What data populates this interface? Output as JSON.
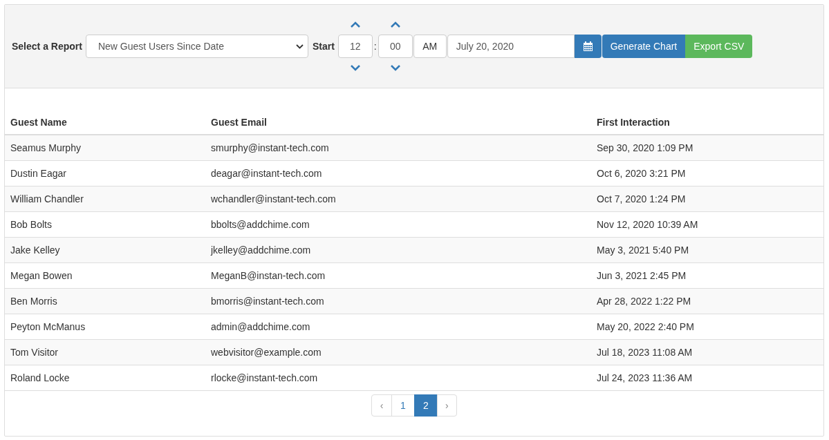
{
  "toolbar": {
    "report_label": "Select a Report",
    "report_value": "New Guest Users Since Date",
    "start_label": "Start",
    "hour": "12",
    "separator": ":",
    "minute": "00",
    "meridian": "AM",
    "date": "July 20, 2020",
    "buttons": [
      {
        "label": "Generate Chart",
        "kind": "primary"
      },
      {
        "label": "Export CSV",
        "kind": "success"
      }
    ]
  },
  "table": {
    "columns": [
      "Guest Name",
      "Guest Email",
      "First Interaction"
    ],
    "rows": [
      [
        "Seamus Murphy",
        "smurphy@instant-tech.com",
        "Sep 30, 2020 1:09 PM"
      ],
      [
        "Dustin Eagar",
        "deagar@instant-tech.com",
        "Oct 6, 2020 3:21 PM"
      ],
      [
        "William Chandler",
        "wchandler@instant-tech.com",
        "Oct 7, 2020 1:24 PM"
      ],
      [
        "Bob Bolts",
        "bbolts@addchime.com",
        "Nov 12, 2020 10:39 AM"
      ],
      [
        "Jake Kelley",
        "jkelley@addchime.com",
        "May 3, 2021 5:40 PM"
      ],
      [
        "Megan Bowen",
        "MeganB@instan-tech.com",
        "Jun 3, 2021 2:45 PM"
      ],
      [
        "Ben Morris",
        "bmorris@instant-tech.com",
        "Apr 28, 2022 1:22 PM"
      ],
      [
        "Peyton McManus",
        "admin@addchime.com",
        "May 20, 2022 2:40 PM"
      ],
      [
        "Tom Visitor",
        "webvisitor@example.com",
        "Jul 18, 2023 11:08 AM"
      ],
      [
        "Roland Locke",
        "rlocke@instant-tech.com",
        "Jul 24, 2023 11:36 AM"
      ]
    ]
  },
  "pagination": [
    {
      "label": "‹",
      "kind": "prev",
      "selected": false
    },
    {
      "label": "1",
      "kind": "page",
      "selected": false
    },
    {
      "label": "2",
      "kind": "page",
      "selected": true
    },
    {
      "label": "›",
      "kind": "next",
      "selected": false
    }
  ]
}
